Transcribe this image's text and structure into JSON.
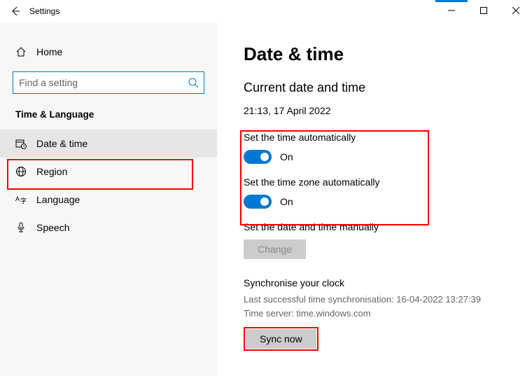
{
  "titlebar": {
    "title": "Settings"
  },
  "sidebar": {
    "home_label": "Home",
    "search_placeholder": "Find a setting",
    "section_label": "Time & Language",
    "items": [
      {
        "label": "Date & time"
      },
      {
        "label": "Region"
      },
      {
        "label": "Language"
      },
      {
        "label": "Speech"
      }
    ]
  },
  "content": {
    "heading": "Date & time",
    "subheading": "Current date and time",
    "current_datetime": "21:13, 17 April 2022",
    "auto_time_label": "Set the time automatically",
    "auto_time_state": "On",
    "auto_tz_label": "Set the time zone automatically",
    "auto_tz_state": "On",
    "manual_label": "Set the date and time manually",
    "change_btn": "Change",
    "sync_heading": "Synchronise your clock",
    "sync_last": "Last successful time synchronisation: 16-04-2022 13:27:39",
    "sync_server": "Time server: time.windows.com",
    "sync_btn": "Sync now"
  }
}
